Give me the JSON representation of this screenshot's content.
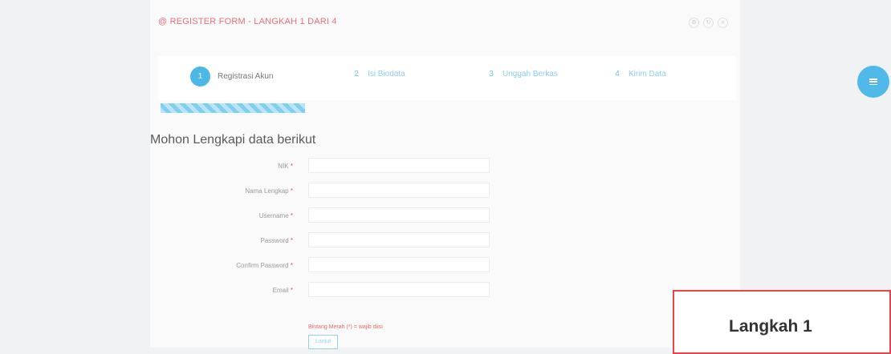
{
  "form_title": "@ REGISTER FORM - LANGKAH 1 DARI 4",
  "tools": [
    "gear-icon",
    "refresh-icon",
    "close-icon"
  ],
  "steps": [
    {
      "num": "1",
      "label": "Registrasi Akun",
      "state": "active"
    },
    {
      "num": "2",
      "label": "Isi Biodata",
      "state": "pending"
    },
    {
      "num": "3",
      "label": "Unggah Berkas",
      "state": "pending"
    },
    {
      "num": "4",
      "label": "Kirim Data",
      "state": "pending"
    }
  ],
  "progress_percent": 25,
  "heading": "Mohon Lengkapi data berikut",
  "fields": [
    {
      "label": "NIK",
      "required_mark": "*",
      "value": ""
    },
    {
      "label": "Nama Lengkap",
      "required_mark": "*",
      "value": ""
    },
    {
      "label": "Username",
      "required_mark": "*",
      "value": ""
    },
    {
      "label": "Password",
      "required_mark": "*",
      "value": ""
    },
    {
      "label": "Confirm Password",
      "required_mark": "*",
      "value": ""
    },
    {
      "label": "Email",
      "required_mark": "*",
      "value": ""
    }
  ],
  "note": "Bintang Merah (*) = wajib diisi",
  "next_button": "Lanjut",
  "fab_icon": "menu-icon",
  "callout": "Langkah 1",
  "colors": {
    "accent": "#4cb8e8",
    "title_red": "#e8707a",
    "callout_border": "#e8454a"
  }
}
